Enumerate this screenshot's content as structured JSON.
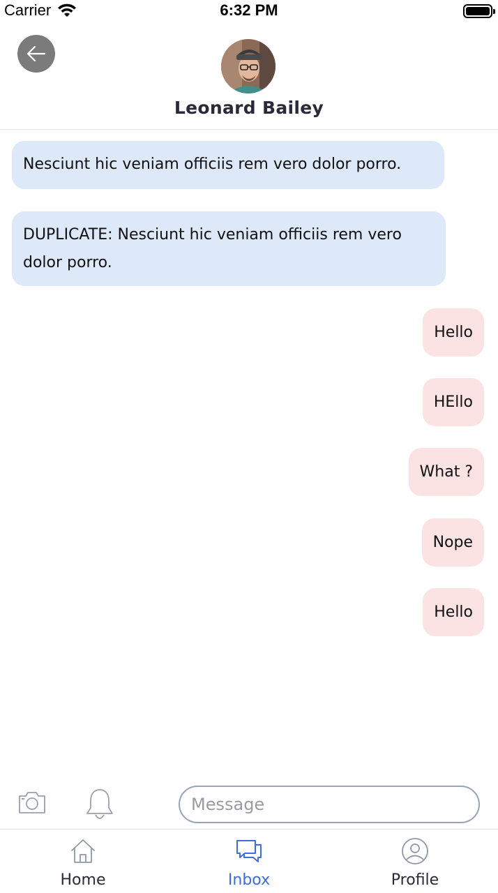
{
  "status_bar": {
    "carrier": "Carrier",
    "time": "6:32 PM"
  },
  "header": {
    "contact_name": "Leonard Bailey"
  },
  "messages": [
    {
      "direction": "incoming",
      "text": "Nesciunt hic veniam officiis rem vero dolor porro."
    },
    {
      "direction": "incoming",
      "text": "DUPLICATE: Nesciunt hic veniam officiis rem vero dolor porro."
    },
    {
      "direction": "outgoing",
      "text": "Hello"
    },
    {
      "direction": "outgoing",
      "text": "HEllo"
    },
    {
      "direction": "outgoing",
      "text": "What ?"
    },
    {
      "direction": "outgoing",
      "text": "Nope"
    },
    {
      "direction": "outgoing",
      "text": "Hello"
    }
  ],
  "composer": {
    "placeholder": "Message",
    "icons": [
      "camera-icon",
      "bell-icon"
    ]
  },
  "tabbar": {
    "tabs": [
      {
        "label": "Home",
        "icon": "home-icon",
        "active": false
      },
      {
        "label": "Inbox",
        "icon": "chat-icon",
        "active": true
      },
      {
        "label": "Profile",
        "icon": "user-circle-icon",
        "active": false
      }
    ]
  },
  "colors": {
    "incoming_bubble": "#dde8f8",
    "outgoing_bubble": "#fbe3e4",
    "accent": "#3e6de0",
    "back_button": "#7b7b7b"
  }
}
